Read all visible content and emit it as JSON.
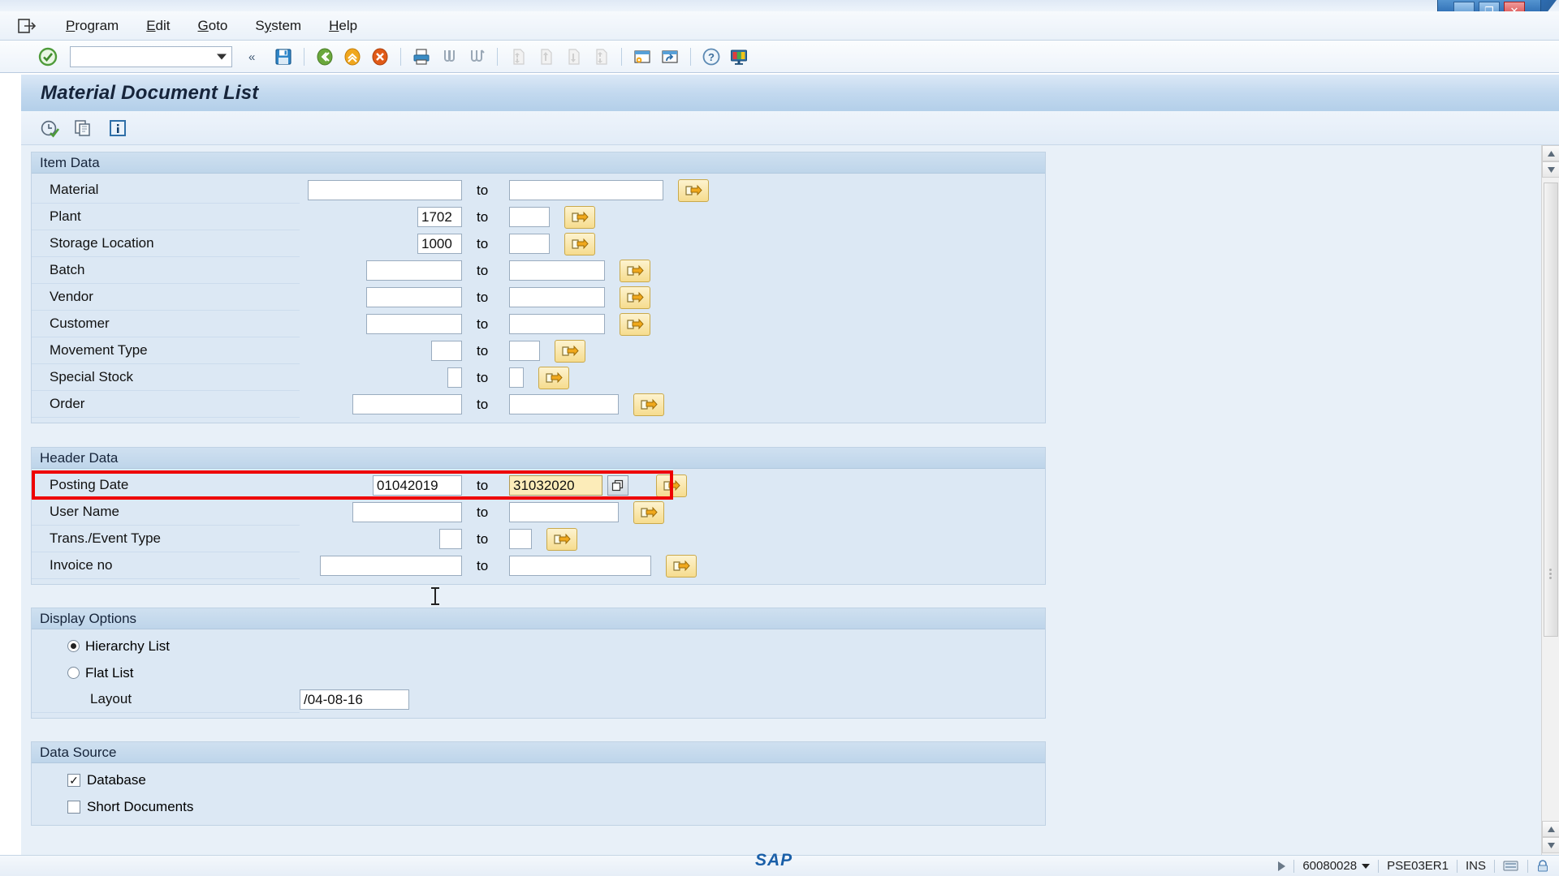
{
  "window": {
    "minimize_label": "–",
    "maximize_label": "❐",
    "close_label": "✕"
  },
  "menubar": {
    "exit_icon": "exit-icon",
    "items": [
      {
        "label": "Program",
        "accel": "P"
      },
      {
        "label": "Edit",
        "accel": "E"
      },
      {
        "label": "Goto",
        "accel": "G"
      },
      {
        "label": "System",
        "accel": "y"
      },
      {
        "label": "Help",
        "accel": "H"
      }
    ]
  },
  "toolbar": {
    "command_field_value": "",
    "command_field_placeholder": "",
    "icons": [
      "enter-check-icon",
      "collapse-left-icon",
      "save-icon",
      "back-green-icon",
      "exit-yellow-icon",
      "cancel-red-icon",
      "print-icon",
      "find-icon",
      "find-next-icon",
      "first-page-icon",
      "previous-page-icon",
      "next-page-icon",
      "last-page-icon",
      "create-session-icon",
      "create-shortcut-icon",
      "help-icon",
      "customize-layout-icon"
    ]
  },
  "screen": {
    "title": "Material Document List",
    "app_toolbar_icons": [
      "execute-icon",
      "copy-variant-icon",
      "info-icon"
    ]
  },
  "item_data": {
    "group_title": "Item Data",
    "to_label": "to",
    "select_button_icon": "multiple-selection-icon",
    "rows": [
      {
        "label": "Material",
        "from": "",
        "to": "",
        "from_width": 190,
        "to_width": 190
      },
      {
        "label": "Plant",
        "from": "1702",
        "to": "",
        "from_width": 55,
        "to_width": 50
      },
      {
        "label": "Storage Location",
        "from": "1000",
        "to": "",
        "from_width": 55,
        "to_width": 50
      },
      {
        "label": "Batch",
        "from": "",
        "to": "",
        "from_width": 118,
        "to_width": 118
      },
      {
        "label": "Vendor",
        "from": "",
        "to": "",
        "from_width": 118,
        "to_width": 118
      },
      {
        "label": "Customer",
        "from": "",
        "to": "",
        "from_width": 118,
        "to_width": 118
      },
      {
        "label": "Movement Type",
        "from": "",
        "to": "",
        "from_width": 38,
        "to_width": 38
      },
      {
        "label": "Special Stock",
        "from": "",
        "to": "",
        "from_width": 18,
        "to_width": 18
      },
      {
        "label": "Order",
        "from": "",
        "to": "",
        "from_width": 135,
        "to_width": 135
      }
    ]
  },
  "header_data": {
    "group_title": "Header Data",
    "to_label": "to",
    "select_button_icon": "multiple-selection-icon",
    "date_picker_icon": "date-picker-icon",
    "highlight_color": "#ee0000",
    "focus_field_color": "#fcecb9",
    "rows": [
      {
        "label": "Posting Date",
        "from": "01042019",
        "to": "31032020",
        "from_width": 110,
        "to_width": 115,
        "focused": true,
        "has_picker": true
      },
      {
        "label": "User Name",
        "from": "",
        "to": "",
        "from_width": 135,
        "to_width": 135,
        "focused": false,
        "has_picker": false
      },
      {
        "label": "Trans./Event Type",
        "from": "",
        "to": "",
        "from_width": 28,
        "to_width": 28,
        "focused": false,
        "has_picker": false
      },
      {
        "label": "Invoice no",
        "from": "",
        "to": "",
        "from_width": 175,
        "to_width": 175,
        "focused": false,
        "has_picker": false
      }
    ]
  },
  "display_options": {
    "group_title": "Display Options",
    "radios": [
      {
        "label": "Hierarchy List",
        "selected": true
      },
      {
        "label": "Flat List",
        "selected": false
      }
    ],
    "layout_label": "Layout",
    "layout_value": "/04-08-16"
  },
  "data_source": {
    "group_title": "Data Source",
    "checkboxes": [
      {
        "label": "Database",
        "checked": true
      },
      {
        "label": "Short Documents",
        "checked": false
      }
    ]
  },
  "statusbar": {
    "session_number": "60080028",
    "system_id": "PSE03ER1",
    "insert_mode": "INS",
    "sap_logo_text": "SAP",
    "ready_icon": "play-triangle-icon",
    "session_dropdown_icon": "chevron-down-icon",
    "server_icon": "server-icon",
    "lock_icon": "lock-icon"
  }
}
